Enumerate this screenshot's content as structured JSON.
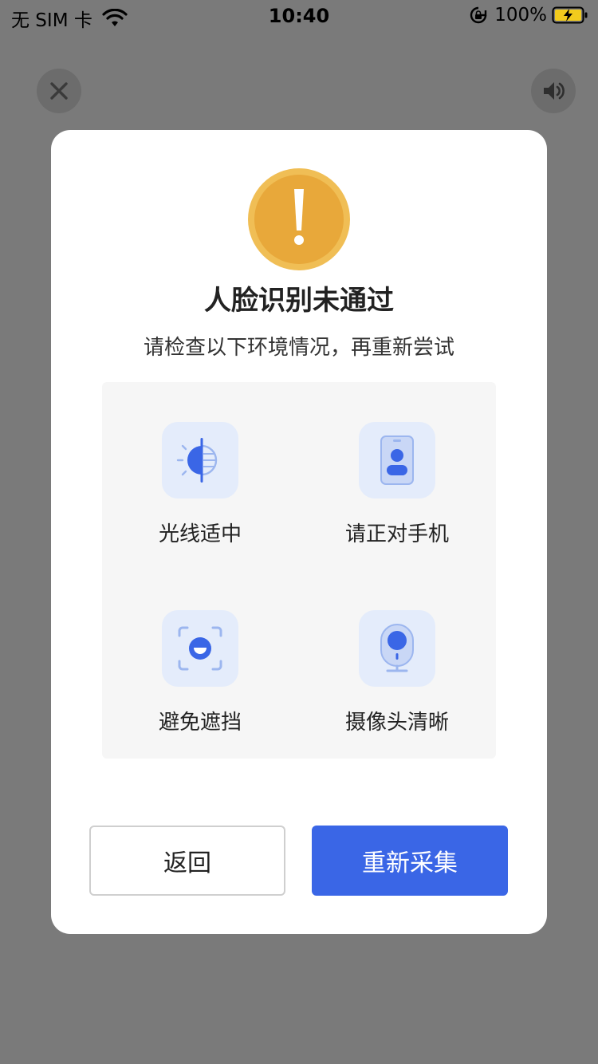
{
  "status_bar": {
    "carrier": "无 SIM 卡",
    "time": "10:40",
    "battery": "100%"
  },
  "top_controls": {
    "close_icon": "close-icon",
    "sound_icon": "speaker-icon"
  },
  "dialog": {
    "icon": "warning-icon",
    "title": "人脸识别未通过",
    "subtitle": "请检查以下环境情况，再重新尝试",
    "tips": [
      {
        "label": "光线适中",
        "icon": "light-icon"
      },
      {
        "label": "请正对手机",
        "icon": "phone-portrait-icon"
      },
      {
        "label": "避免遮挡",
        "icon": "face-scan-icon"
      },
      {
        "label": "摄像头清晰",
        "icon": "camera-icon"
      }
    ],
    "back_label": "返回",
    "retry_label": "重新采集"
  },
  "colors": {
    "overlay": "#7a7a7a",
    "primary": "#3a66e6",
    "warning": "#e8a83a",
    "tip_icon_bg": "#e4ecfb",
    "panel_bg": "#f6f6f6"
  }
}
